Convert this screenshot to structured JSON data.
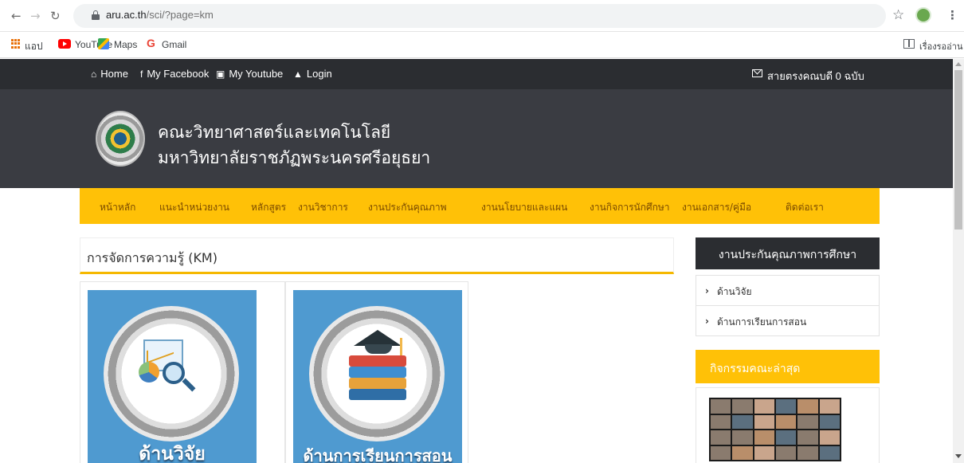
{
  "browser": {
    "url_host": "aru.ac.th",
    "url_path": "/sci/?page=km",
    "bookmarks": {
      "apps": "แอป",
      "youtube": "YouTube",
      "maps": "Maps",
      "gmail": "Gmail",
      "reading_list": "เรื่องรออ่าน"
    }
  },
  "topbar": {
    "home": "Home",
    "facebook": "My Facebook",
    "youtube": "My Youtube",
    "login": "Login",
    "mailbox": "สายตรงคณบดี 0 ฉบับ"
  },
  "header": {
    "title_line1": "คณะวิทยาศาสตร์และเทคโนโลยี",
    "title_line2": "มหาวิทยาลัยราชภัฏพระนครศรีอยุธยา"
  },
  "nav": [
    "หน้าหลัก",
    "แนะนำหน่วยงาน",
    "หลักสูตร",
    "งานวิชาการ",
    "งานประกันคุณภาพ",
    "งานนโยบายและแผน",
    "งานกิจการนักศึกษา",
    "งานเอกสาร/คู่มือ",
    "ติดต่อเรา"
  ],
  "main": {
    "section_title": "การจัดการความรู้ (KM)",
    "cards": [
      {
        "label": "ด้านวิจัย"
      },
      {
        "label": "ด้านการเรียนการสอน"
      }
    ]
  },
  "sidebar": {
    "qa_title": "งานประกันคุณภาพการศึกษา",
    "qa_items": [
      "ด้านวิจัย",
      "ด้านการเรียนการสอน"
    ],
    "activity_title": "กิจกรรมคณะล่าสุด"
  }
}
